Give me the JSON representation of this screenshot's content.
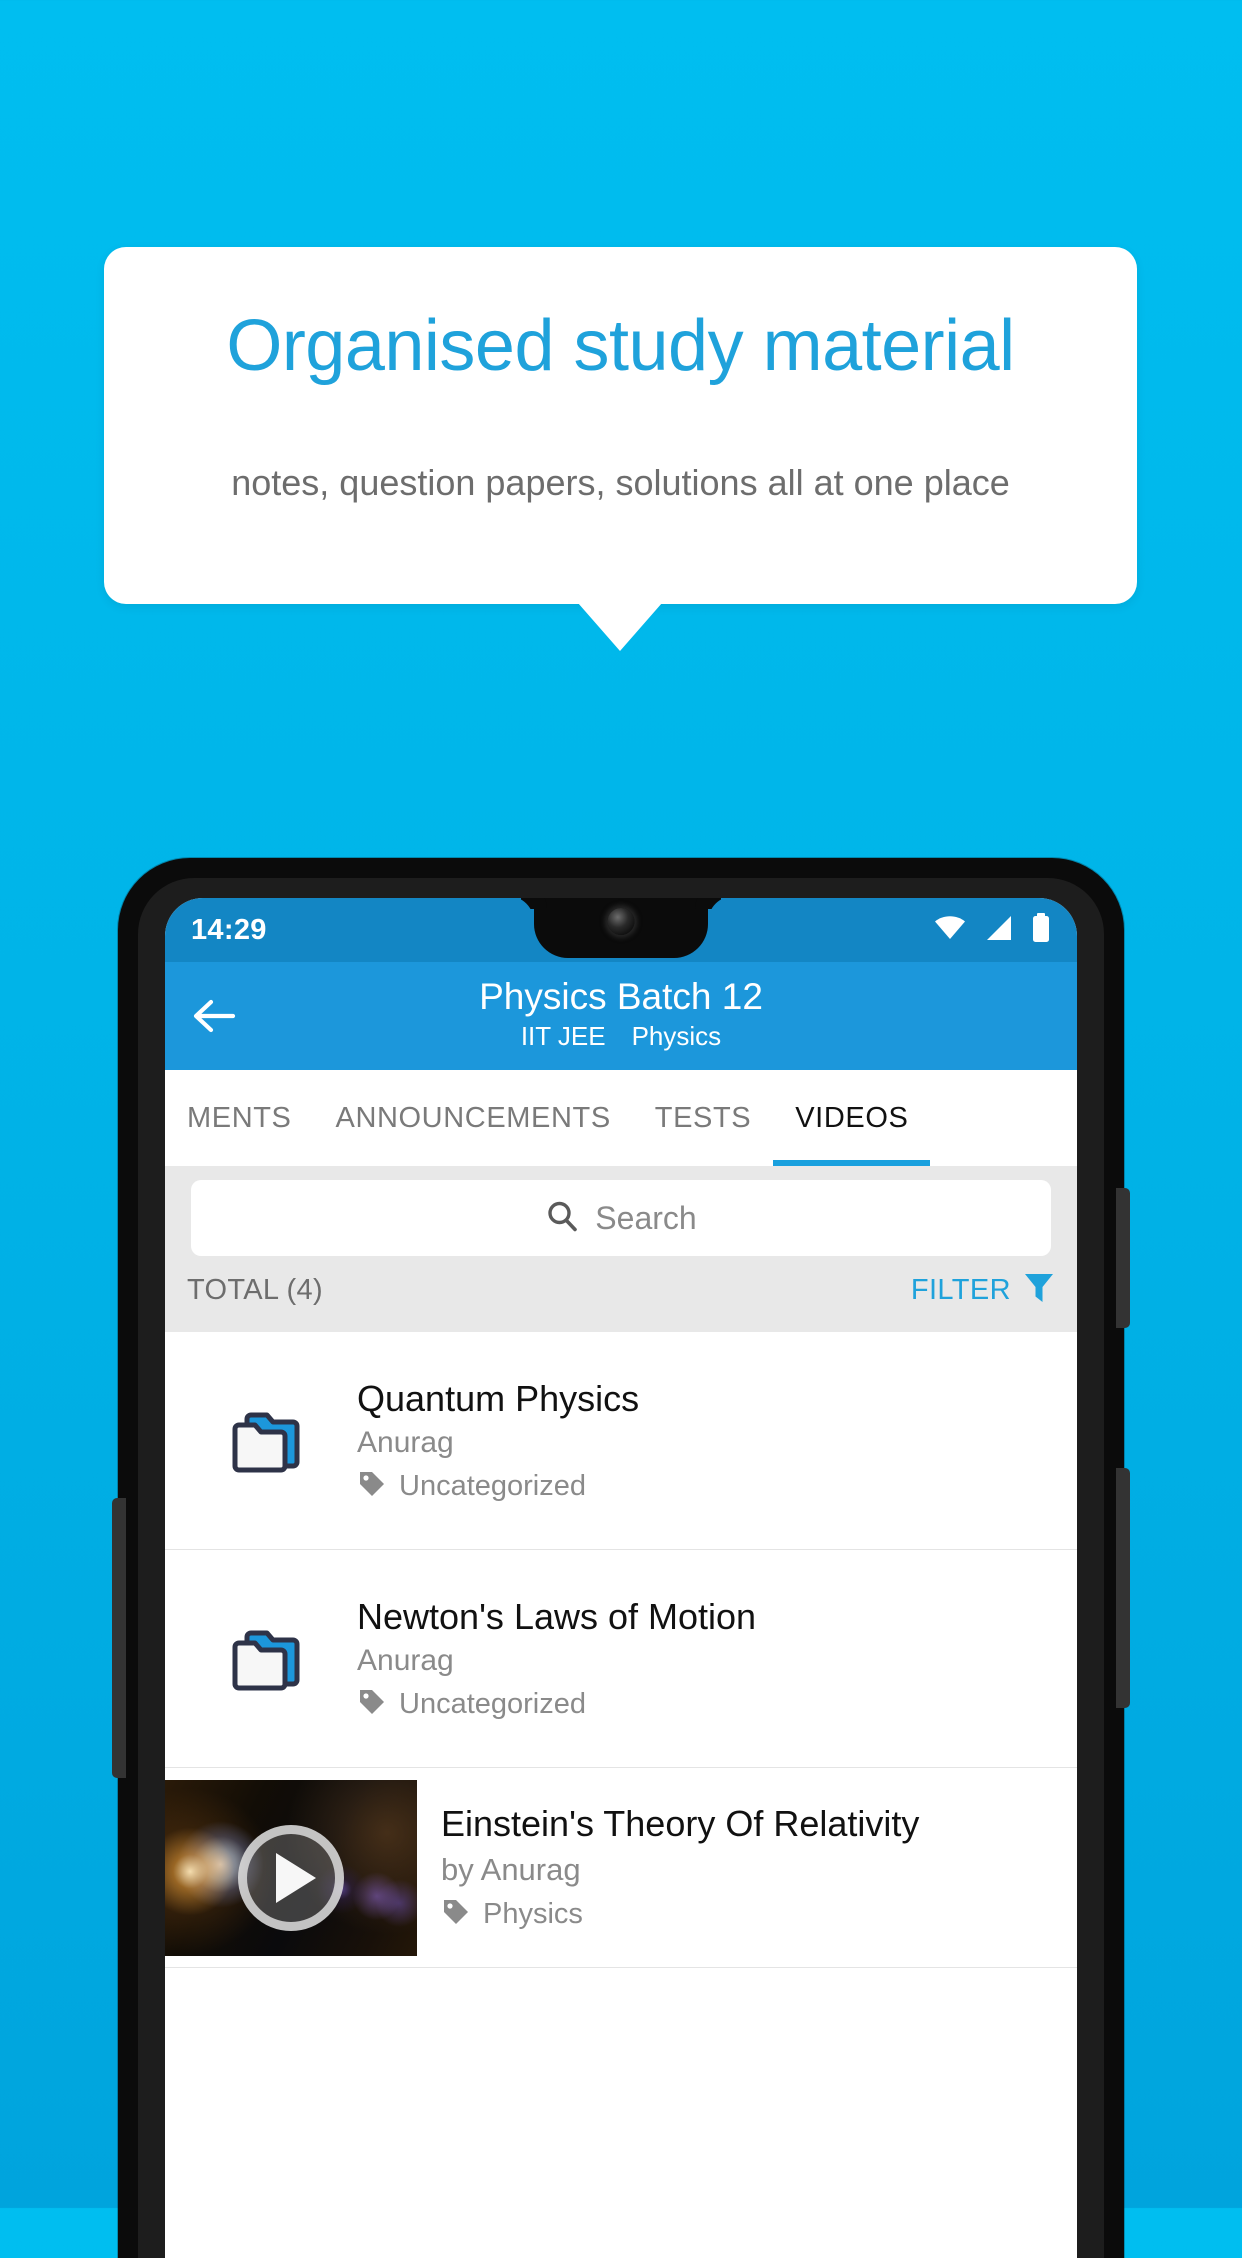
{
  "promo": {
    "headline": "Organised study material",
    "subtitle": "notes, question papers, solutions all at one place",
    "headline_color": "#1FA2DB",
    "background_color": "#00BEF0"
  },
  "phone": {
    "status_bar": {
      "time": "14:29",
      "icons": [
        "wifi-icon",
        "signal-icon",
        "battery-icon"
      ],
      "background_color": "#1386C4"
    },
    "app_bar": {
      "back_icon": "back-arrow-icon",
      "title": "Physics Batch 12",
      "subtitle_exam": "IIT JEE",
      "subtitle_subject": "Physics",
      "background_color": "#1C97DB"
    },
    "tabs": [
      {
        "label": "MENTS",
        "active": false
      },
      {
        "label": "ANNOUNCEMENTS",
        "active": false
      },
      {
        "label": "TESTS",
        "active": false
      },
      {
        "label": "VIDEOS",
        "active": true
      }
    ],
    "search": {
      "placeholder": "Search",
      "value": "",
      "icon": "search-icon"
    },
    "toolbar": {
      "total_label": "TOTAL (4)",
      "filter_label": "FILTER",
      "filter_icon": "funnel-icon",
      "filter_color": "#1FA2DB"
    },
    "list": [
      {
        "type": "folder",
        "icon": "folder-stack-icon",
        "title": "Quantum Physics",
        "author": "Anurag",
        "tag_icon": "tag-icon",
        "tag": "Uncategorized"
      },
      {
        "type": "folder",
        "icon": "folder-stack-icon",
        "title": "Newton's Laws of Motion",
        "author": "Anurag",
        "tag_icon": "tag-icon",
        "tag": "Uncategorized"
      },
      {
        "type": "video",
        "icon": "video-thumbnail",
        "play_icon": "play-icon",
        "title": "Einstein's Theory Of Relativity",
        "author": "by Anurag",
        "tag_icon": "tag-icon",
        "tag": "Physics"
      }
    ]
  }
}
